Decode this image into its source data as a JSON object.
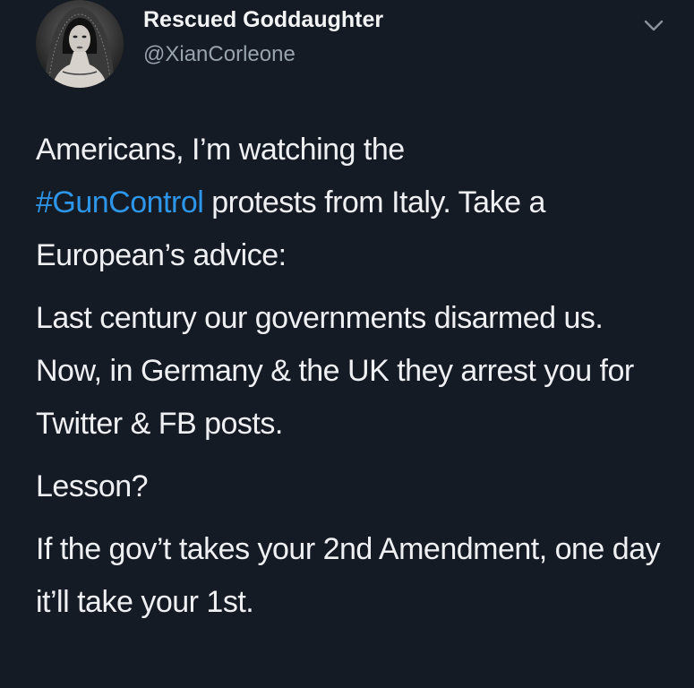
{
  "user": {
    "display_name": "Rescued Goddaughter",
    "handle": "@XianCorleone",
    "avatar_icon": "profile-photo"
  },
  "menu": {
    "icon": "chevron-down-icon"
  },
  "tweet": {
    "p1_before": "Americans, I’m watching the",
    "p1_hashtag": "#GunControl",
    "p1_after": " protests from Italy. Take a European’s advice:",
    "p2": "Last century our governments disarmed us. Now, in Germany & the UK they arrest you for Twitter & FB posts.",
    "p3": "Lesson?",
    "p4": "If the gov’t takes your 2nd Amendment, one day it’ll take your 1st."
  },
  "colors": {
    "background": "#151b25",
    "hashtag": "#2d96e8",
    "handle": "#98a3ae"
  }
}
